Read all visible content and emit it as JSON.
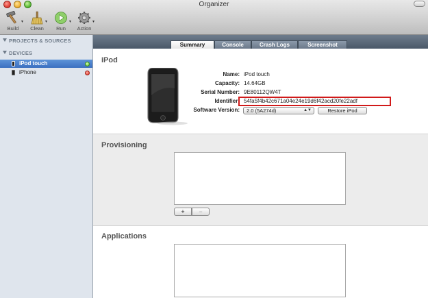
{
  "window": {
    "title": "Organizer"
  },
  "toolbar": {
    "build_label": "Build",
    "clean_label": "Clean",
    "run_label": "Run",
    "action_label": "Action"
  },
  "sidebar": {
    "projects_header": "PROJECTS & SOURCES",
    "devices_header": "DEVICES",
    "devices": [
      {
        "name": "iPod touch",
        "status": "connected",
        "selected": true
      },
      {
        "name": "iPhone",
        "status": "error",
        "selected": false
      }
    ]
  },
  "tabs": [
    {
      "label": "Summary",
      "active": true
    },
    {
      "label": "Console",
      "active": false
    },
    {
      "label": "Crash Logs",
      "active": false
    },
    {
      "label": "Screenshot",
      "active": false
    }
  ],
  "summary": {
    "device_heading": "iPod",
    "fields": {
      "name_label": "Name:",
      "name_value": "iPod touch",
      "capacity_label": "Capacity:",
      "capacity_value": "14.64GB",
      "serial_label": "Serial Number:",
      "serial_value": "9E80112QW4T",
      "identifier_label": "Identifier:",
      "identifier_value": "54fa5f4b42c671a04e24e19d6f42acd20fe22adf",
      "software_label": "Software Version:",
      "software_value": "2.0 (5A274d)"
    },
    "restore_button": "Restore iPod"
  },
  "provisioning": {
    "heading": "Provisioning",
    "add_label": "+",
    "remove_label": "−"
  },
  "applications": {
    "heading": "Applications"
  },
  "colors": {
    "highlight": "#d11a1a",
    "selection": "#3b6fc0",
    "tabbar": "#4a5868",
    "sidebar": "#dfe5ed"
  }
}
